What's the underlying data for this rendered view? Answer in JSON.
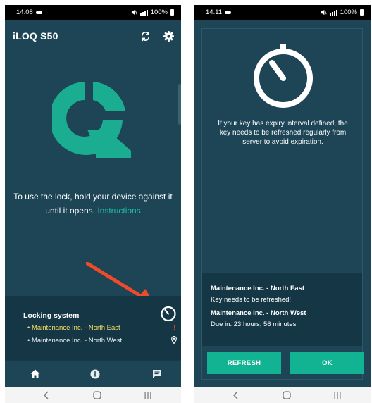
{
  "screen1": {
    "status": {
      "time": "14:08",
      "battery": "100%"
    },
    "header": {
      "title": "iLOQ S50",
      "sync_icon": "sync-icon",
      "settings_icon": "gear-icon"
    },
    "instructions": {
      "text": "To use the lock, hold your device against it until it opens.",
      "link": "Instructions"
    },
    "locking_system": {
      "title": "Locking system",
      "items": [
        {
          "label": "• Maintenance Inc. - North East",
          "indicator": "!",
          "state": "attention"
        },
        {
          "label": "• Maintenance Inc. - North West",
          "indicator_icon": "location-pin-icon",
          "state": "normal"
        }
      ],
      "timer_icon": "stopwatch-icon"
    },
    "bottom_nav": [
      "home-icon",
      "info-icon",
      "chat-icon"
    ],
    "colors": {
      "background": "#1d4556",
      "panel": "#143645",
      "accent": "#1dc1a4",
      "highlight": "#f2e066",
      "alert": "#e23b2f",
      "arrow": "#ef4a2a"
    }
  },
  "screen2": {
    "status": {
      "time": "14:11",
      "battery": "100%"
    },
    "dialog": {
      "icon": "stopwatch-icon",
      "message": "If your key has expiry interval defined, the key needs to be refreshed regularly from server to avoid expiration.",
      "keys": [
        {
          "name": "Maintenance Inc. - North East",
          "status": "Key needs to be refreshed!"
        },
        {
          "name": "Maintenance Inc. - North West",
          "status": "Due in: 23 hours, 56 minutes"
        }
      ],
      "buttons": {
        "refresh": "REFRESH",
        "ok": "OK"
      }
    },
    "colors": {
      "button": "#12b392"
    }
  }
}
